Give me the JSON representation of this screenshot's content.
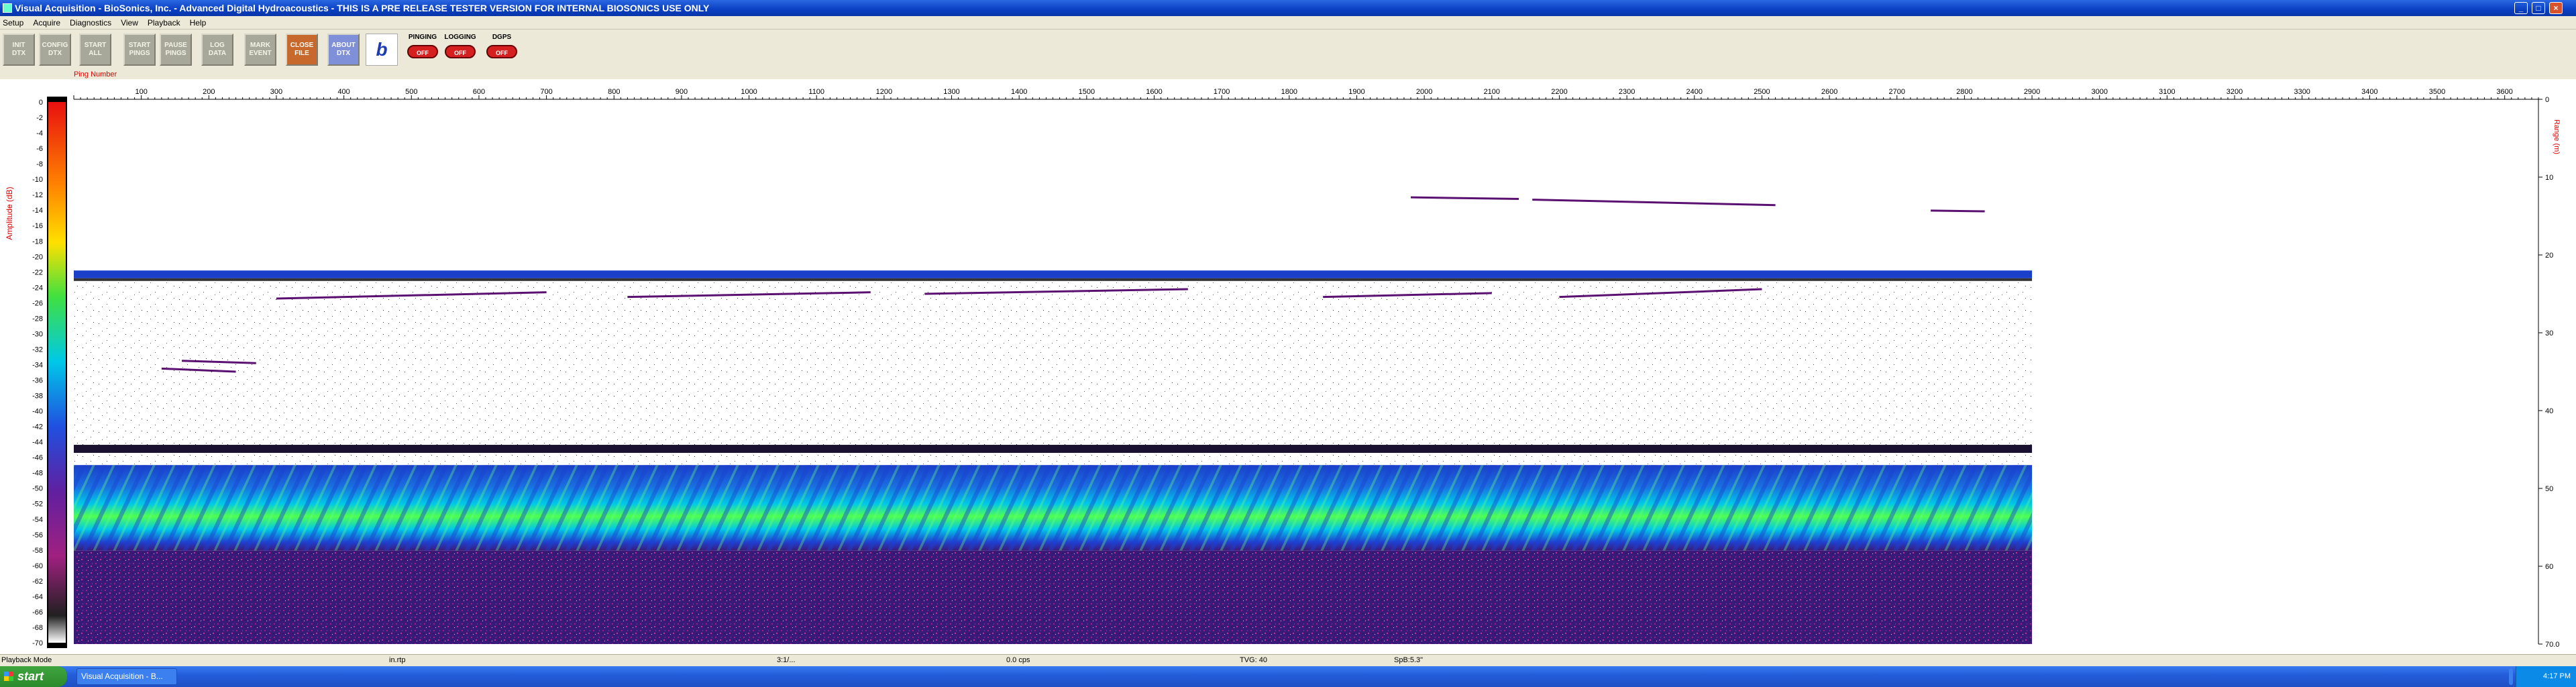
{
  "window": {
    "title": "Visual Acquisition  -  BioSonics, Inc.  -  Advanced Digital Hydroacoustics  -  THIS IS A PRE RELEASE TESTER VERSION FOR INTERNAL BIOSONICS USE ONLY"
  },
  "menu": [
    "Setup",
    "Acquire",
    "Diagnostics",
    "View",
    "Playback",
    "Help"
  ],
  "toolbar": {
    "buttons": [
      {
        "label": "INIT\nDTX"
      },
      {
        "label": "CONFIG\nDTX"
      },
      {
        "label": "START\nALL"
      },
      {
        "label": "START\nPINGS"
      },
      {
        "label": "PAUSE\nPINGS"
      },
      {
        "label": "LOG\nDATA"
      },
      {
        "label": "MARK\nEVENT"
      },
      {
        "label": "CLOSE\nFILE"
      },
      {
        "label": "ABOUT\nDTX"
      }
    ],
    "logo_text": "b",
    "toggles": [
      {
        "title": "PINGING",
        "state": "OFF"
      },
      {
        "title": "LOGGING",
        "state": "OFF"
      },
      {
        "title": "DGPS",
        "state": "OFF"
      }
    ]
  },
  "echogram": {
    "x_axis_label": "Ping Number",
    "amplitude_label": "Amplitude (dB)",
    "range_label": "Range (m)",
    "amplitude_ticks": [
      0,
      -2,
      -4,
      -6,
      -8,
      -10,
      -12,
      -14,
      -16,
      -18,
      -20,
      -22,
      -24,
      -26,
      -28,
      -30,
      -32,
      -34,
      -36,
      -38,
      -40,
      -42,
      -44,
      -46,
      -48,
      -50,
      -52,
      -54,
      -56,
      -58,
      -60,
      -62,
      -64,
      -66,
      -68,
      -70
    ],
    "ping_ticks": [
      100,
      200,
      300,
      400,
      500,
      600,
      700,
      800,
      900,
      1000,
      1100,
      1200,
      1300,
      1400,
      1500,
      1600,
      1700,
      1800,
      1900,
      2000,
      2100,
      2200,
      2300,
      2400,
      2500,
      2600,
      2700,
      2800,
      2900,
      3000,
      3100,
      3200,
      3300,
      3400,
      3500,
      3600
    ],
    "range_ticks": [
      "0",
      "10",
      "20",
      "30",
      "40",
      "50",
      "60",
      "70.0"
    ],
    "ping_range": [
      0,
      3650
    ],
    "depth_range_m": [
      0,
      70
    ],
    "pings_recorded": 2900,
    "surface_layer_m": [
      22,
      23
    ],
    "bottom_line_m": 45,
    "bottom_layer_m": [
      47,
      58
    ],
    "colors": {
      "bottom_blue": "#1a3fc8",
      "bottom_cyan": "#00e8f0",
      "bottom_green": "#50ff50",
      "deep_purple": "#3a1a78",
      "trace": "#5a1070"
    }
  },
  "status_bar": {
    "mode": "Playback Mode",
    "input": "in.rtp",
    "time": "3:1/...",
    "rate": "0.0 cps",
    "tvg": "TVG: 40",
    "spb": "SpB:5.3\""
  },
  "taskbar": {
    "start_label": "start",
    "tasks": [
      "Visual Acquisition - B...",
      ""
    ],
    "clock": "4:17 PM"
  }
}
